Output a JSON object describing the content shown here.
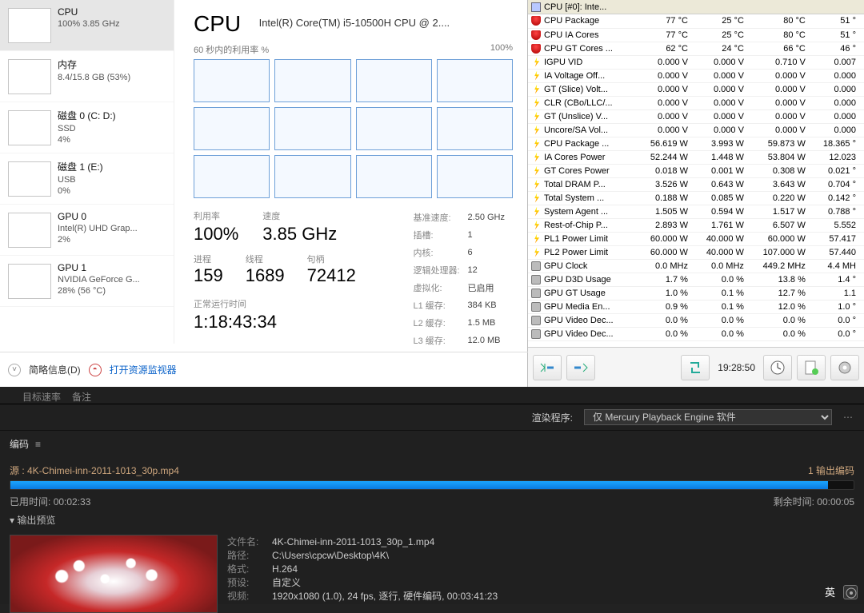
{
  "taskmgr": {
    "sidebar": [
      {
        "title": "CPU",
        "sub": "100% 3.85 GHz",
        "thumb": "cpu",
        "selected": true
      },
      {
        "title": "内存",
        "sub": "8.4/15.8 GB (53%)",
        "thumb": "mem"
      },
      {
        "title": "磁盘 0 (C: D:)",
        "sub": "SSD",
        "sub2": "4%",
        "thumb": "disk"
      },
      {
        "title": "磁盘 1 (E:)",
        "sub": "USB",
        "sub2": "0%",
        "thumb": "disk"
      },
      {
        "title": "GPU 0",
        "sub": "Intel(R) UHD Grap...",
        "sub2": "2%",
        "thumb": "gpu"
      },
      {
        "title": "GPU 1",
        "sub": "NVIDIA GeForce G...",
        "sub2": "28% (56 °C)",
        "thumb": "gpu"
      }
    ],
    "cpu_title": "CPU",
    "cpu_model": "Intel(R) Core(TM) i5-10500H CPU @ 2....",
    "graph_label": "60 秒内的利用率 %",
    "graph_right": "100%",
    "util_lbl": "利用率",
    "util_val": "100%",
    "speed_lbl": "速度",
    "speed_val": "3.85 GHz",
    "proc_lbl": "进程",
    "proc_val": "159",
    "thr_lbl": "线程",
    "thr_val": "1689",
    "hnd_lbl": "句柄",
    "hnd_val": "72412",
    "sys": [
      [
        "基准速度:",
        "2.50 GHz"
      ],
      [
        "插槽:",
        "1"
      ],
      [
        "内核:",
        "6"
      ],
      [
        "逻辑处理器:",
        "12"
      ],
      [
        "虚拟化:",
        "已启用"
      ],
      [
        "L1 缓存:",
        "384 KB"
      ],
      [
        "L2 缓存:",
        "1.5 MB"
      ],
      [
        "L3 缓存:",
        "12.0 MB"
      ]
    ],
    "uptime_lbl": "正常运行时间",
    "uptime_val": "1:18:43:34",
    "foot_brief": "简略信息(D)",
    "foot_link": "打开资源监视器"
  },
  "hwinfo": {
    "group": "CPU [#0]: Inte...",
    "rows": [
      {
        "icon": "temp",
        "name": "CPU Package",
        "c": [
          "77 °C",
          "25 °C",
          "80 °C",
          "51 °"
        ]
      },
      {
        "icon": "temp",
        "name": "CPU IA Cores",
        "c": [
          "77 °C",
          "25 °C",
          "80 °C",
          "51 °"
        ]
      },
      {
        "icon": "temp",
        "name": "CPU GT Cores ...",
        "c": [
          "62 °C",
          "24 °C",
          "66 °C",
          "46 °"
        ]
      },
      {
        "icon": "volt",
        "name": "IGPU VID",
        "c": [
          "0.000 V",
          "0.000 V",
          "0.710 V",
          "0.007"
        ]
      },
      {
        "icon": "volt",
        "name": "IA Voltage Off...",
        "c": [
          "0.000 V",
          "0.000 V",
          "0.000 V",
          "0.000"
        ]
      },
      {
        "icon": "volt",
        "name": "GT (Slice) Volt...",
        "c": [
          "0.000 V",
          "0.000 V",
          "0.000 V",
          "0.000"
        ]
      },
      {
        "icon": "volt",
        "name": "CLR (CBo/LLC/...",
        "c": [
          "0.000 V",
          "0.000 V",
          "0.000 V",
          "0.000"
        ]
      },
      {
        "icon": "volt",
        "name": "GT (Unslice) V...",
        "c": [
          "0.000 V",
          "0.000 V",
          "0.000 V",
          "0.000"
        ]
      },
      {
        "icon": "volt",
        "name": "Uncore/SA Vol...",
        "c": [
          "0.000 V",
          "0.000 V",
          "0.000 V",
          "0.000"
        ]
      },
      {
        "icon": "volt",
        "name": "CPU Package ...",
        "c": [
          "56.619 W",
          "3.993 W",
          "59.873 W",
          "18.365 °"
        ]
      },
      {
        "icon": "volt",
        "name": "IA Cores Power",
        "c": [
          "52.244 W",
          "1.448 W",
          "53.804 W",
          "12.023"
        ]
      },
      {
        "icon": "volt",
        "name": "GT Cores Power",
        "c": [
          "0.018 W",
          "0.001 W",
          "0.308 W",
          "0.021 °"
        ]
      },
      {
        "icon": "volt",
        "name": "Total DRAM P...",
        "c": [
          "3.526 W",
          "0.643 W",
          "3.643 W",
          "0.704 °"
        ]
      },
      {
        "icon": "volt",
        "name": "Total System ...",
        "c": [
          "0.188 W",
          "0.085 W",
          "0.220 W",
          "0.142 °"
        ]
      },
      {
        "icon": "volt",
        "name": "System Agent ...",
        "c": [
          "1.505 W",
          "0.594 W",
          "1.517 W",
          "0.788 °"
        ]
      },
      {
        "icon": "volt",
        "name": "Rest-of-Chip P...",
        "c": [
          "2.893 W",
          "1.761 W",
          "6.507 W",
          "5.552"
        ]
      },
      {
        "icon": "volt",
        "name": "PL1 Power Limit",
        "c": [
          "60.000 W",
          "40.000 W",
          "60.000 W",
          "57.417"
        ]
      },
      {
        "icon": "volt",
        "name": "PL2 Power Limit",
        "c": [
          "60.000 W",
          "40.000 W",
          "107.000 W",
          "57.440"
        ]
      },
      {
        "icon": "gpu",
        "name": "GPU Clock",
        "c": [
          "0.0 MHz",
          "0.0 MHz",
          "449.2 MHz",
          "4.4 MH"
        ]
      },
      {
        "icon": "gpu",
        "name": "GPU D3D Usage",
        "c": [
          "1.7 %",
          "0.0 %",
          "13.8 %",
          "1.4 °"
        ]
      },
      {
        "icon": "gpu",
        "name": "GPU GT Usage",
        "c": [
          "1.0 %",
          "0.1 %",
          "12.7 %",
          "1.1"
        ]
      },
      {
        "icon": "gpu",
        "name": "GPU Media En...",
        "c": [
          "0.9 %",
          "0.1 %",
          "12.0 %",
          "1.0 °"
        ]
      },
      {
        "icon": "gpu",
        "name": "GPU Video Dec...",
        "c": [
          "0.0 %",
          "0.0 %",
          "0.0 %",
          "0.0 °"
        ]
      },
      {
        "icon": "gpu",
        "name": "GPU Video Dec...",
        "c": [
          "0.0 %",
          "0.0 %",
          "0.0 %",
          "0.0 °"
        ]
      }
    ],
    "time": "19:28:50"
  },
  "encoder": {
    "tabs": [
      "目标速率",
      "备注"
    ],
    "render_lbl": "渲染程序:",
    "render_opt": "仅 Mercury Playback Engine 软件",
    "encode_lbl": "编码",
    "source_lbl": "源 : 4K-Chimei-inn-2011-1013_30p.mp4",
    "out_count": "1 输出编码",
    "elapsed_lbl": "已用时间:",
    "elapsed_val": "00:02:33",
    "remain_lbl": "剩余时间:",
    "remain_val": "00:00:05",
    "preview_lbl": "输出预览",
    "meta": [
      [
        "文件名:",
        "4K-Chimei-inn-2011-1013_30p_1.mp4"
      ],
      [
        "路径:",
        "C:\\Users\\cpcw\\Desktop\\4K\\"
      ],
      [
        "格式:",
        "H.264"
      ],
      [
        "预设:",
        "自定义"
      ],
      [
        "视频:",
        "1920x1080 (1.0), 24 fps, 逐行, 硬件编码, 00:03:41:23"
      ]
    ],
    "ime": "英"
  }
}
